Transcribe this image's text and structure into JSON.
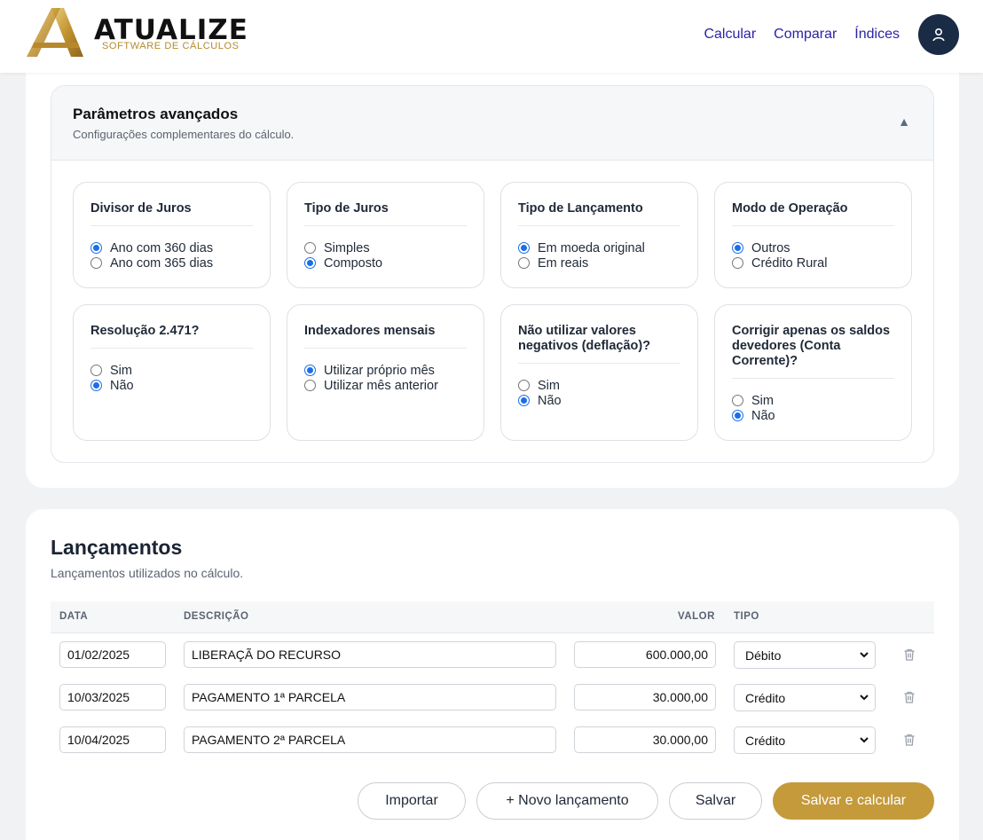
{
  "brand": {
    "name": "ATUALIZE",
    "tagline": "SOFTWARE DE CÁLCULOS"
  },
  "nav": {
    "items": [
      "Calcular",
      "Comparar",
      "Índices"
    ]
  },
  "advanced": {
    "title": "Parâmetros avançados",
    "subtitle": "Configurações complementares do cálculo.",
    "toggle": "▲",
    "groups": [
      {
        "title": "Divisor de Juros",
        "options": [
          "Ano com 360 dias",
          "Ano com 365 dias"
        ],
        "selected": 0
      },
      {
        "title": "Tipo de Juros",
        "options": [
          "Simples",
          "Composto"
        ],
        "selected": 1
      },
      {
        "title": "Tipo de Lançamento",
        "options": [
          "Em moeda original",
          "Em reais"
        ],
        "selected": 0
      },
      {
        "title": "Modo de Operação",
        "options": [
          "Outros",
          "Crédito Rural"
        ],
        "selected": 0
      },
      {
        "title": "Resolução 2.471?",
        "options": [
          "Sim",
          "Não"
        ],
        "selected": 1
      },
      {
        "title": "Indexadores mensais",
        "options": [
          "Utilizar próprio mês",
          "Utilizar mês anterior"
        ],
        "selected": 0
      },
      {
        "title": "Não utilizar valores negativos (deflação)?",
        "options": [
          "Sim",
          "Não"
        ],
        "selected": 1
      },
      {
        "title": "Corrigir apenas os saldos devedores (Conta Corrente)?",
        "options": [
          "Sim",
          "Não"
        ],
        "selected": 1
      }
    ]
  },
  "entries": {
    "title": "Lançamentos",
    "subtitle": "Lançamentos utilizados no cálculo.",
    "columns": {
      "date": "DATA",
      "description": "DESCRIÇÃO",
      "value": "VALOR",
      "type": "TIPO"
    },
    "rows": [
      {
        "date": "01/02/2025",
        "description": "LIBERAÇÃ DO RECURSO",
        "value": "600.000,00",
        "type": "Débito"
      },
      {
        "date": "10/03/2025",
        "description": "PAGAMENTO 1ª PARCELA",
        "value": "30.000,00",
        "type": "Crédito"
      },
      {
        "date": "10/04/2025",
        "description": "PAGAMENTO 2ª PARCELA",
        "value": "30.000,00",
        "type": "Crédito"
      }
    ]
  },
  "actions": {
    "import": "Importar",
    "new_entry": "+ Novo lançamento",
    "save": "Salvar",
    "save_and_calc": "Salvar e calcular"
  },
  "colors": {
    "accent_gold": "#c49a3a",
    "nav_link": "#2a24a8",
    "avatar_bg": "#1a2b45",
    "radio_blue": "#1a6fe8"
  }
}
